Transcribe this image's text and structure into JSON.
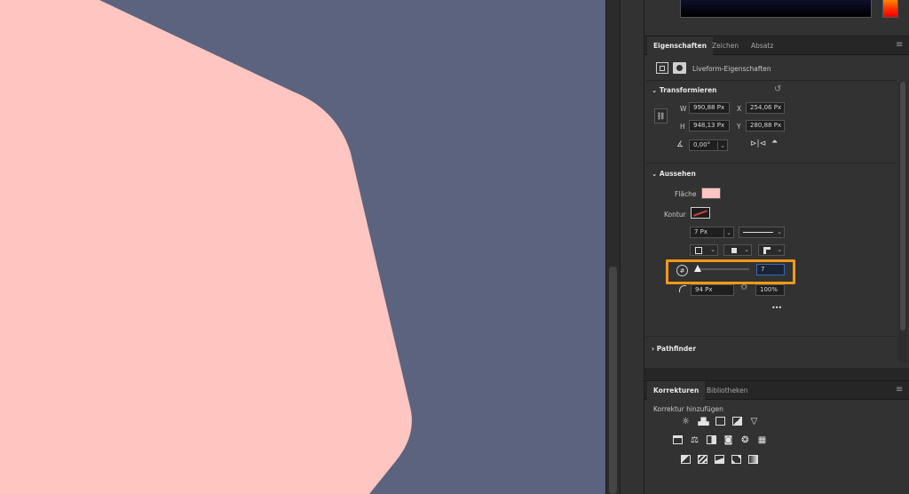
{
  "colors": {
    "canvas_bg": "#5b637f",
    "shape_fill": "#ffc5c0",
    "highlight": "#f09a17",
    "panel_bg": "#323232"
  },
  "properties_panel": {
    "tabs": [
      "Eigenschaften",
      "Zeichen",
      "Absatz"
    ],
    "context_label": "Liveform-Eigenschaften",
    "transform": {
      "title": "Transformieren",
      "w_label": "W",
      "w_value": "990,88 Px",
      "x_label": "X",
      "x_value": "254,06 Px",
      "h_label": "H",
      "h_value": "948,13 Px",
      "y_label": "Y",
      "y_value": "280,88 Px",
      "angle_value": "0,00°"
    },
    "appearance": {
      "title": "Aussehen",
      "fill_label": "Fläche",
      "fill_color": "#ffc5c0",
      "stroke_label": "Kontur",
      "stroke_width": "7 Px",
      "sides_value": "7",
      "sides_slider_fraction": 0.0,
      "corner_radius": "94 Px",
      "star_ratio": "100%",
      "more_label": "•••"
    },
    "pathfinder": {
      "title": "Pathfinder"
    }
  },
  "adjustments_panel": {
    "tabs": [
      "Korrekturen",
      "Bibliotheken"
    ],
    "add_label": "Korrektur hinzufügen",
    "icons": {
      "row1": [
        "brightness-icon",
        "levels-icon",
        "curves-icon",
        "exposure-icon",
        "vibrance-icon"
      ],
      "row2": [
        "hue-saturation-icon",
        "color-balance-icon",
        "black-white-icon",
        "photo-filter-icon",
        "channel-mixer-icon",
        "color-lookup-icon"
      ],
      "row3": [
        "invert-icon",
        "posterize-icon",
        "threshold-icon",
        "selective-color-icon",
        "gradient-map-icon"
      ]
    }
  }
}
